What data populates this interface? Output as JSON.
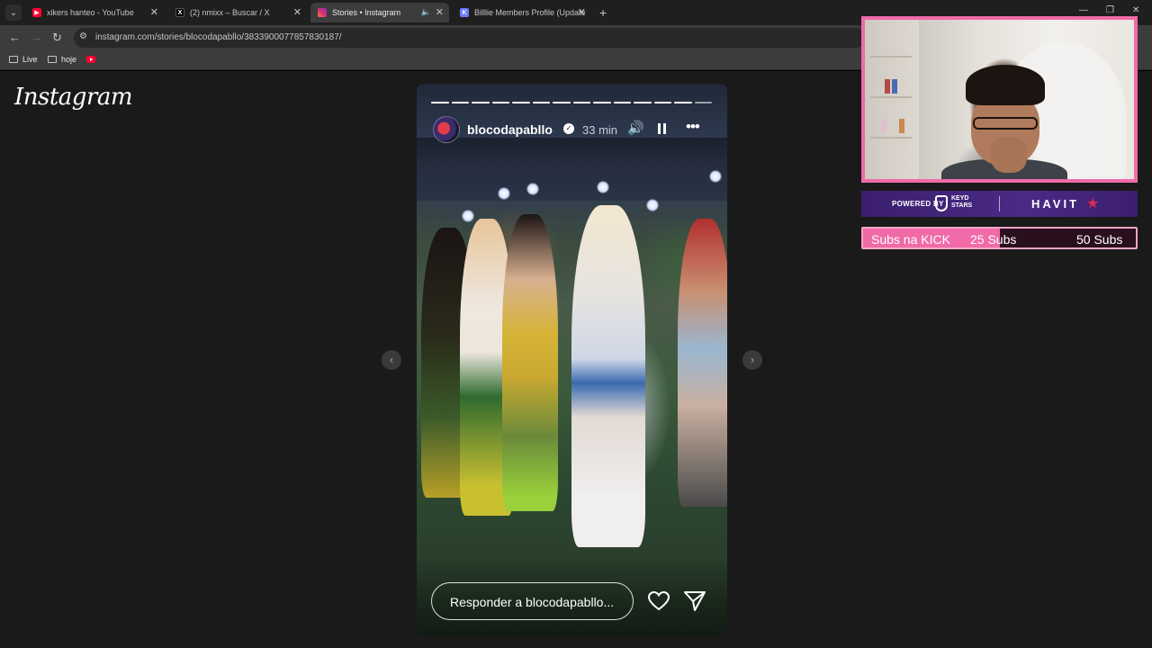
{
  "browser": {
    "tabs": [
      {
        "title": "xikers hanteo - YouTube",
        "favicon": "youtube-icon",
        "active": false
      },
      {
        "title": "(2) nmixx – Buscar / X",
        "favicon": "x-icon",
        "active": false
      },
      {
        "title": "Stories • Instagram",
        "favicon": "instagram-icon",
        "active": true
      },
      {
        "title": "Billlie Members Profile (Update",
        "favicon": "k-icon",
        "active": false
      }
    ],
    "url": "instagram.com/stories/blocodapabllo/3833900077857830187/",
    "bookmarks": [
      {
        "label": "Live"
      },
      {
        "label": "hoje"
      }
    ]
  },
  "page": {
    "logo": "Instagram"
  },
  "story": {
    "username": "blocodapabllo",
    "time": "33 min",
    "progress_segments_total": 14,
    "progress_segments_done": 13,
    "reply_placeholder": "Responder a blocodapabllo..."
  },
  "overlay": {
    "sponsor_powered": "POWERED BY",
    "sponsor_keyd": "KEYD STARS",
    "sponsor_havit": "HAVIT",
    "subs_label": "Subs na KICK",
    "subs_current": "25 Subs",
    "subs_goal": "50 Subs",
    "subs_progress": 0.5
  },
  "colors": {
    "accent_pink": "#f06aa8",
    "sponsor_purple": "#4a2a86",
    "tab_bg": "#1f1f1f",
    "toolbar_bg": "#3c3c3c"
  }
}
